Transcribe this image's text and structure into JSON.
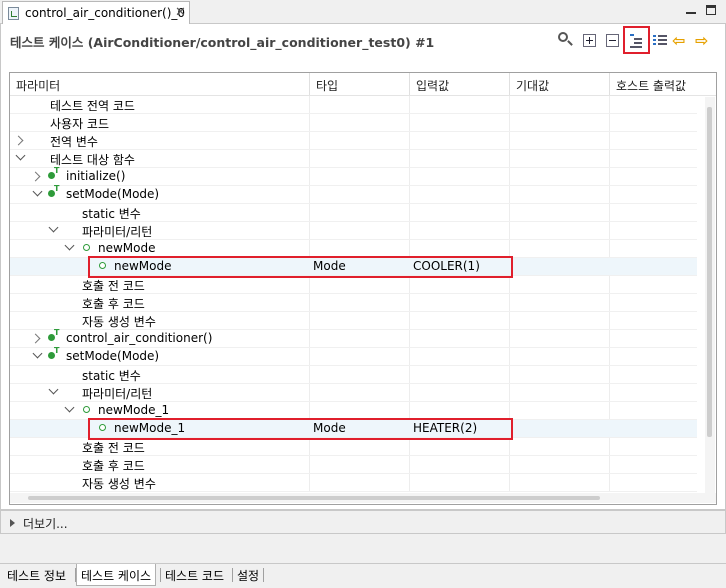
{
  "tab": {
    "title": "control_air_conditioner()_0",
    "close": "✕"
  },
  "header": {
    "title": "테스트 케이스 (AirConditioner/control_air_conditioner_test0) #1"
  },
  "toolbar": {
    "back": "⇦",
    "forward": "⇨"
  },
  "columns": [
    "파라미터",
    "타입",
    "입력값",
    "기대값",
    "호스트 출력값"
  ],
  "rows": [
    {
      "label": "테스트 전역 코드",
      "type": "",
      "input": ""
    },
    {
      "label": "사용자 코드",
      "type": "",
      "input": ""
    },
    {
      "label": "전역 변수",
      "type": "",
      "input": ""
    },
    {
      "label": "테스트 대상 함수",
      "type": "",
      "input": ""
    },
    {
      "label": "initialize()",
      "type": "",
      "input": ""
    },
    {
      "label": "setMode(Mode)",
      "type": "",
      "input": ""
    },
    {
      "label": "static 변수",
      "type": "",
      "input": ""
    },
    {
      "label": "파라미터/리턴",
      "type": "",
      "input": ""
    },
    {
      "label": "newMode",
      "type": "",
      "input": ""
    },
    {
      "label": "newMode",
      "type": "Mode",
      "input": "COOLER(1)"
    },
    {
      "label": "호출 전 코드",
      "type": "",
      "input": ""
    },
    {
      "label": "호출 후 코드",
      "type": "",
      "input": ""
    },
    {
      "label": "자동 생성 변수",
      "type": "",
      "input": ""
    },
    {
      "label": "control_air_conditioner()",
      "type": "",
      "input": ""
    },
    {
      "label": "setMode(Mode)",
      "type": "",
      "input": ""
    },
    {
      "label": "static 변수",
      "type": "",
      "input": ""
    },
    {
      "label": "파라미터/리턴",
      "type": "",
      "input": ""
    },
    {
      "label": "newMode_1",
      "type": "",
      "input": ""
    },
    {
      "label": "newMode_1",
      "type": "Mode",
      "input": "HEATER(2)"
    },
    {
      "label": "호출 전 코드",
      "type": "",
      "input": ""
    },
    {
      "label": "호출 후 코드",
      "type": "",
      "input": ""
    },
    {
      "label": "자동 생성 변수",
      "type": "",
      "input": ""
    }
  ],
  "more": {
    "label": "더보기..."
  },
  "bottom_tabs": [
    "테스트 정보",
    "테스트 케이스",
    "테스트 코드",
    "설정"
  ],
  "colors": {
    "highlight": "#e01f2c",
    "icon_green": "#2e9b3a",
    "arrow": "#e6a100"
  }
}
